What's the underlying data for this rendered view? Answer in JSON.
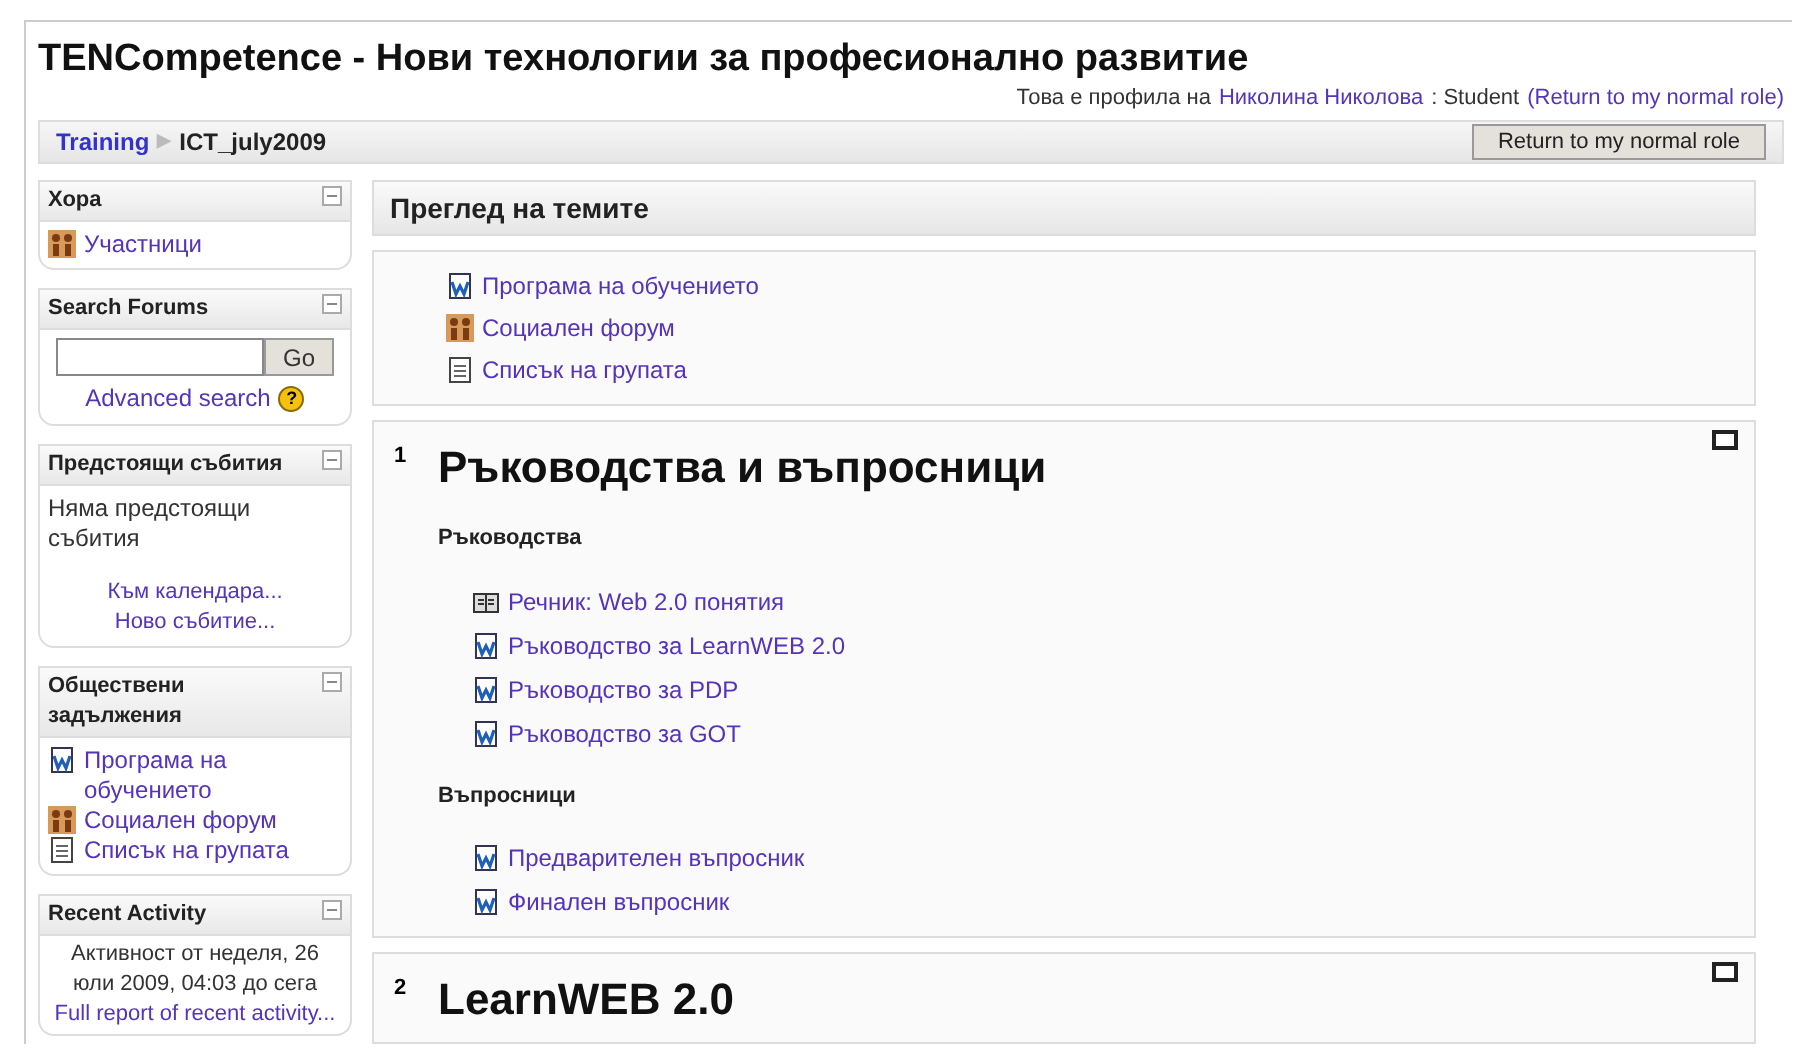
{
  "header": {
    "title": "TENCompetence - Нови технологии за професионално развитие",
    "profile": {
      "prefix": "Това е профила на",
      "user": "Николина Николова",
      "role": ": Student",
      "link": "(Return to my normal role)"
    }
  },
  "breadcrumb": {
    "items": [
      "Training",
      "ICT_july2009"
    ],
    "separator": "▶"
  },
  "return_button": "Return to my normal role",
  "sidebar": [
    {
      "kind": "links",
      "title": "Хора",
      "items": [
        {
          "kind": "people",
          "label": "Участници"
        }
      ]
    },
    {
      "kind": "search",
      "title": "Search Forums",
      "button": "Go",
      "link": "Advanced search",
      "help": "?"
    },
    {
      "kind": "events",
      "title": "Предстоящи събития",
      "text": "Няма предстоящи събития",
      "links": [
        "Към календара...",
        "Ново събитие..."
      ]
    },
    {
      "kind": "links",
      "title": "Обществени задължения",
      "items": [
        {
          "kind": "doc",
          "label": "Програма на обучението"
        },
        {
          "kind": "forum",
          "label": "Социален форум"
        },
        {
          "kind": "list",
          "label": "Списък на групата"
        }
      ]
    },
    {
      "kind": "activity",
      "title": "Recent Activity",
      "text": "Активност от неделя, 26 юли 2009, 04:03 до сега",
      "link": "Full report of recent activity..."
    }
  ],
  "main": {
    "title": "Преглед на темите",
    "intro": [
      {
        "kind": "doc",
        "label": "Програма на обучението"
      },
      {
        "kind": "forum",
        "label": "Социален форум"
      },
      {
        "kind": "list",
        "label": "Списък на групата"
      }
    ],
    "sections": [
      {
        "number": "1",
        "title": "Ръководства и въпросници",
        "checked": false,
        "groups": [
          {
            "heading": "Ръководства",
            "items": [
              {
                "kind": "glossary",
                "label": "Речник: Web 2.0 понятия"
              },
              {
                "kind": "doc",
                "label": "Ръководство за LearnWEB 2.0"
              },
              {
                "kind": "doc",
                "label": "Ръководство за PDP"
              },
              {
                "kind": "doc",
                "label": "Ръководство за GOT"
              }
            ]
          },
          {
            "heading": "Въпросници",
            "items": [
              {
                "kind": "doc",
                "label": "Предварителен въпросник"
              },
              {
                "kind": "doc",
                "label": "Финален въпросник"
              }
            ]
          }
        ]
      },
      {
        "number": "2",
        "title": "LearnWEB 2.0",
        "checked": false
      }
    ]
  }
}
